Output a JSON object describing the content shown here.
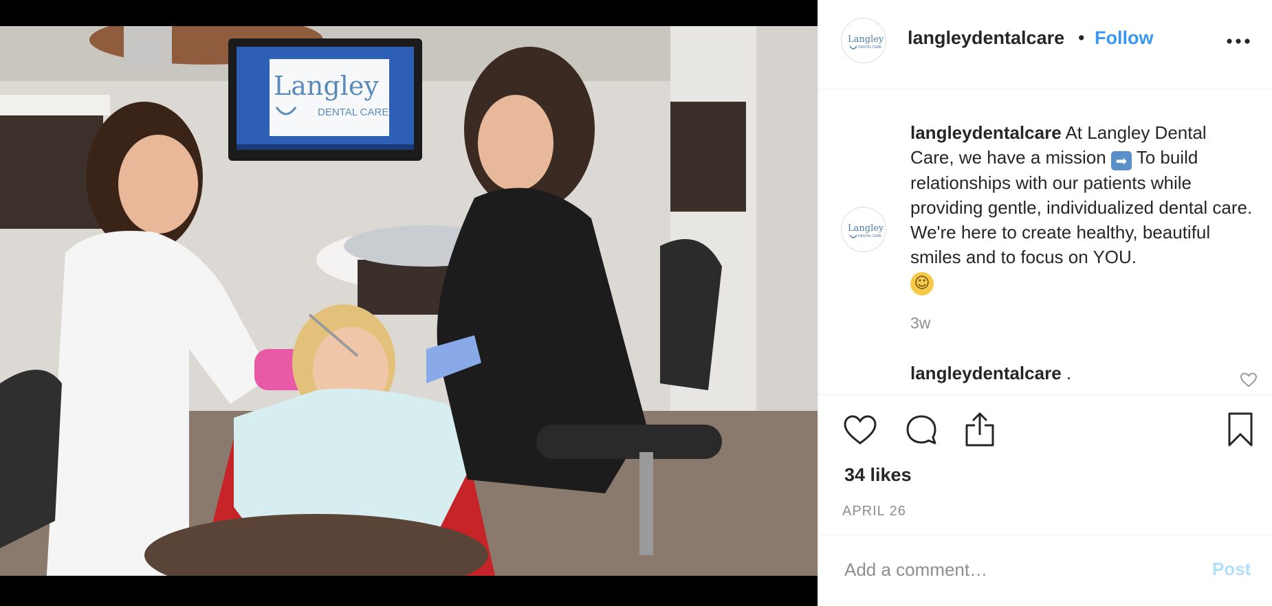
{
  "post": {
    "image_alt": "Dental hygienists treating a patient in a dental chair",
    "monitor_logo": {
      "line1": "Langley",
      "line2": "DENTAL CARE"
    },
    "header": {
      "username": "langleydentalcare",
      "separator": "•",
      "follow_label": "Follow",
      "more_icon": "more-horizontal-icon",
      "avatar_logo": {
        "line1": "Langley",
        "line2": "DENTAL CARE"
      }
    },
    "caption": {
      "username": "langleydentalcare",
      "text_part1": "At Langley Dental Care, we have a mission",
      "emoji_arrow": "➡",
      "text_part2": "To build relationships with our patients while providing gentle, individualized dental care. We're here to create healthy, beautiful smiles and to focus on YOU.",
      "emoji_smile": "😁",
      "time": "3w"
    },
    "comments": [
      {
        "username": "langleydentalcare",
        "text": "."
      }
    ],
    "actions": {
      "like_icon": "heart-icon",
      "comment_icon": "speech-bubble-icon",
      "share_icon": "share-icon",
      "save_icon": "bookmark-icon"
    },
    "likes_text": "34 likes",
    "date": "APRIL 26",
    "add_comment": {
      "placeholder": "Add a comment…",
      "post_label": "Post"
    },
    "colors": {
      "link_blue": "#3897f0",
      "post_disabled": "#b2dffc",
      "muted": "#8e8e8e"
    }
  }
}
